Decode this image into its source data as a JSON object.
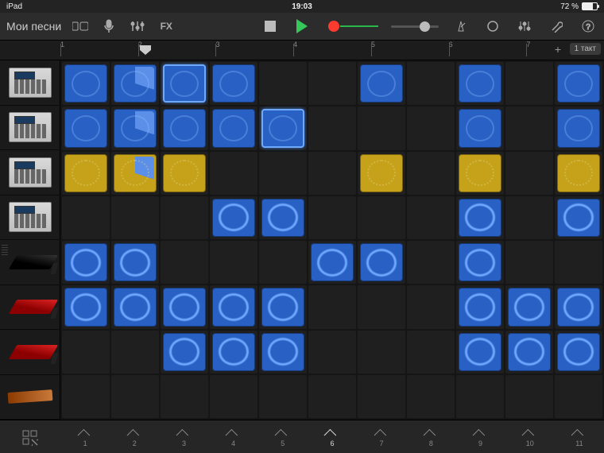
{
  "status": {
    "left": "iPad",
    "time": "19:03",
    "battery_pct": "72 %"
  },
  "toolbar": {
    "back": "Мои песни",
    "fx": "FX"
  },
  "timeline": {
    "ticks": [
      "1",
      "2",
      "3",
      "4",
      "5",
      "6",
      "7"
    ],
    "badge": "1 такт",
    "playhead_at": 2
  },
  "tracks": [
    {
      "kind": "mpc",
      "cells": [
        "blue",
        "blue",
        "blue-hi",
        "blue",
        "",
        "",
        "blue",
        "",
        "blue",
        "",
        "blue"
      ]
    },
    {
      "kind": "mpc",
      "cells": [
        "blue",
        "blue",
        "blue",
        "blue",
        "blue-hi",
        "",
        "",
        "",
        "blue",
        "",
        "blue"
      ]
    },
    {
      "kind": "mpc",
      "cells": [
        "yellow",
        "yellow",
        "yellow",
        "",
        "",
        "",
        "yellow",
        "",
        "yellow",
        "",
        "yellow"
      ]
    },
    {
      "kind": "mpc",
      "cells": [
        "",
        "",
        "",
        "blue-wav",
        "blue-wav",
        "",
        "",
        "",
        "blue-wav",
        "",
        "blue-wav"
      ]
    },
    {
      "kind": "kb",
      "cells": [
        "blue-wav",
        "blue-wav",
        "",
        "",
        "",
        "blue-wav",
        "blue-wav",
        "",
        "blue-wav",
        "",
        ""
      ]
    },
    {
      "kind": "kbred",
      "cells": [
        "blue-wav",
        "blue-wav",
        "blue-wav",
        "blue-wav",
        "blue-wav",
        "",
        "",
        "",
        "blue-wav",
        "blue-wav",
        "blue-wav"
      ]
    },
    {
      "kind": "kbred",
      "cells": [
        "",
        "",
        "blue-wav",
        "blue-wav",
        "blue-wav",
        "",
        "",
        "",
        "blue-wav",
        "blue-wav",
        "blue-wav"
      ]
    },
    {
      "kind": "gtr",
      "cells": [
        "",
        "",
        "",
        "",
        "",
        "",
        "",
        "",
        "",
        "",
        ""
      ]
    }
  ],
  "footer_cols": [
    "1",
    "2",
    "3",
    "4",
    "5",
    "6",
    "7",
    "8",
    "9",
    "10",
    "11"
  ],
  "footer_active": 6
}
